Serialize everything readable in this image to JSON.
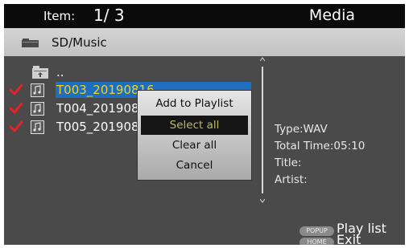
{
  "header": {
    "item_label": "Item:",
    "item_count": "1/ 3",
    "title": "Media"
  },
  "path": {
    "icon": "folder-icon",
    "text": "SD/Music"
  },
  "list": {
    "items": [
      {
        "label": "..",
        "icon": "folder-up-icon",
        "checked": false
      },
      {
        "label": "T003_20190816",
        "icon": "music-file-icon",
        "checked": true,
        "highlighted": true
      },
      {
        "label": "T004_20190816",
        "icon": "music-file-icon",
        "checked": true
      },
      {
        "label": "T005_20190816",
        "icon": "music-file-icon",
        "checked": true
      }
    ]
  },
  "info": {
    "type": "Type:WAV",
    "total_time": "Total Time:05:10",
    "title": "Title:",
    "artist": "Artist:"
  },
  "menu": {
    "items": [
      "Add to Playlist",
      "Select all",
      "Clear all",
      "Cancel"
    ],
    "highlighted": "Select all"
  },
  "footer": {
    "popup_badge": "POPUP",
    "popup_label": "Play list",
    "home_badge": "HOME",
    "home_label": "Exit"
  },
  "colors": {
    "background": "#4a4a4a",
    "top_bar": "#0b0b0b",
    "selection": "#1f6fc0",
    "selected_text": "#f0d020",
    "check_mark": "#e8202a",
    "menu_highlight_text": "#b8ba6a"
  }
}
